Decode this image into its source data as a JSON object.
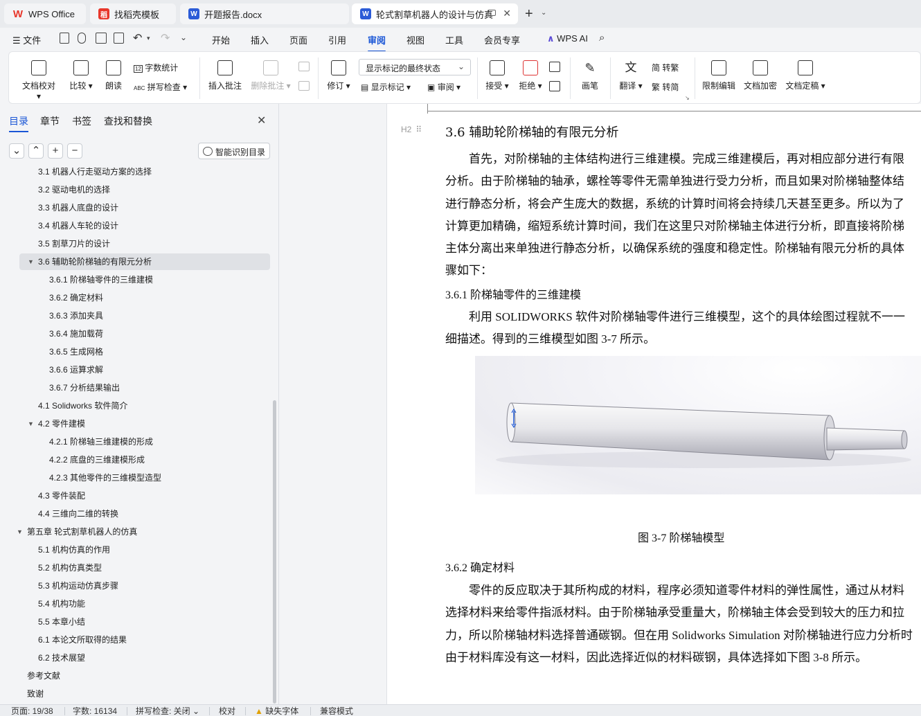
{
  "tabs": [
    {
      "label": "WPS Office",
      "icon": "wps-logo-icon"
    },
    {
      "label": "找稻壳模板",
      "icon": "docer-icon"
    },
    {
      "label": "开题报告.docx",
      "icon": "word-doc-icon"
    },
    {
      "label": "轮式割草机器人的设计与仿真",
      "icon": "word-doc-icon"
    }
  ],
  "menu": {
    "file": "文件",
    "items": [
      "开始",
      "插入",
      "页面",
      "引用",
      "审阅",
      "视图",
      "工具",
      "会员专享"
    ],
    "active": "审阅",
    "wps_ai": "WPS AI"
  },
  "ribbon": {
    "doc_check": "文档校对",
    "compare": "比较",
    "read_aloud": "朗读",
    "word_count": "字数统计",
    "spell_check": "拼写检查",
    "insert_comment": "插入批注",
    "delete_comment": "删除批注",
    "track_changes": "修订",
    "markup_state": "显示标记的最终状态",
    "show_markup": "显示标记",
    "review_pane": "审阅",
    "accept": "接受",
    "reject": "拒绝",
    "pen": "画笔",
    "translate": "翻译",
    "to_traditional": "转繁",
    "to_simplified": "转简",
    "restrict_edit": "限制编辑",
    "encrypt": "文档加密",
    "finalize": "文档定稿"
  },
  "nav": {
    "tabs": [
      "目录",
      "章节",
      "书签",
      "查找和替换"
    ],
    "smart_toc": "智能识别目录",
    "toc": [
      {
        "label": "3.1 机器人行走驱动方案的选择",
        "level": 2
      },
      {
        "label": "3.2 驱动电机的选择",
        "level": 2
      },
      {
        "label": "3.3 机器人底盘的设计",
        "level": 2
      },
      {
        "label": "3.4  机器人车轮的设计",
        "level": 2
      },
      {
        "label": "3.5 割草刀片的设计",
        "level": 2
      },
      {
        "label": "3.6  辅助轮阶梯轴的有限元分析",
        "level": 2,
        "expanded": true,
        "selected": true
      },
      {
        "label": "3.6.1  阶梯轴零件的三维建模",
        "level": 3
      },
      {
        "label": "3.6.2  确定材料",
        "level": 3
      },
      {
        "label": "3.6.3  添加夹具",
        "level": 3
      },
      {
        "label": "3.6.4  施加载荷",
        "level": 3
      },
      {
        "label": "3.6.5  生成网格",
        "level": 3
      },
      {
        "label": "3.6.6  运算求解",
        "level": 3
      },
      {
        "label": "3.6.7  分析结果输出",
        "level": 3
      },
      {
        "label": "4.1 Solidworks 软件简介",
        "level": 2
      },
      {
        "label": "4.2  零件建模",
        "level": 2,
        "expanded": true
      },
      {
        "label": "4.2.1 阶梯轴三维建模的形成",
        "level": 3
      },
      {
        "label": "4.2.2  底盘的三维建模形成",
        "level": 3
      },
      {
        "label": "4.2.3 其他零件的三维模型造型",
        "level": 3
      },
      {
        "label": "4.3 零件装配",
        "level": 2
      },
      {
        "label": "4.4 三维向二维的转换",
        "level": 2
      },
      {
        "label": "第五章  轮式割草机器人的仿真",
        "level": 1,
        "expanded": true
      },
      {
        "label": "5.1 机构仿真的作用",
        "level": 2
      },
      {
        "label": "5.2 机构仿真类型",
        "level": 2
      },
      {
        "label": "5.3 机构运动仿真步骤",
        "level": 2
      },
      {
        "label": "5.4  机构功能",
        "level": 2
      },
      {
        "label": "5.5  本章小结",
        "level": 2
      },
      {
        "label": "6.1  本论文所取得的结果",
        "level": 2
      },
      {
        "label": "6.2  技术展望",
        "level": 2
      },
      {
        "label": "参考文献",
        "level": 1
      },
      {
        "label": "致谢",
        "level": 1
      }
    ]
  },
  "doc": {
    "heading_marker": "H2",
    "h2": "3.6  辅助轮阶梯轴的有限元分析",
    "p1": [
      "首先，对阶梯轴的主体结构进行三维建模。完成三维建模后，再对相应部分进行有限",
      "分析。由于阶梯轴的轴承，螺栓等零件无需单独进行受力分析，而且如果对阶梯轴整体结",
      "进行静态分析，将会产生庞大的数据，系统的计算时间将会持续几天甚至更多。所以为了",
      "计算更加精确，缩短系统计算时间，我们在这里只对阶梯轴主体进行分析，即直接将阶梯",
      "主体分离出来单独进行静态分析，以确保系统的强度和稳定性。阶梯轴有限元分析的具体",
      "骤如下："
    ],
    "h3_1": "3.6.1  阶梯轴零件的三维建模",
    "p2": [
      "利用 SOLIDWORKS 软件对阶梯轴零件进行三维模型，这个的具体绘图过程就不一一",
      "细描述。得到的三维模型如图 3-7 所示。"
    ],
    "figure_caption": "图 3-7    阶梯轴模型",
    "h3_2": "3.6.2  确定材料",
    "p3": [
      "零件的反应取决于其所构成的材料，程序必须知道零件材料的弹性属性，通过从材料",
      "选择材料来给零件指派材料。由于阶梯轴承受重量大，阶梯轴主体会受到较大的压力和拉",
      "力，所以阶梯轴材料选择普通碳钢。但在用 Solidworks Simulation 对阶梯轴进行应力分析时",
      "由于材料库没有这一材料，因此选择近似的材料碳钢，具体选择如下图 3-8 所示。"
    ]
  },
  "status": {
    "page": "页面: 19/38",
    "words": "字数: 16134",
    "spell": "拼写检查: 关闭",
    "proof": "校对",
    "missing_font": "缺失字体",
    "compat": "兼容模式"
  },
  "colors": {
    "accent": "#1a56d6",
    "wps_red": "#e8372b",
    "word_blue": "#2b5bd7"
  }
}
